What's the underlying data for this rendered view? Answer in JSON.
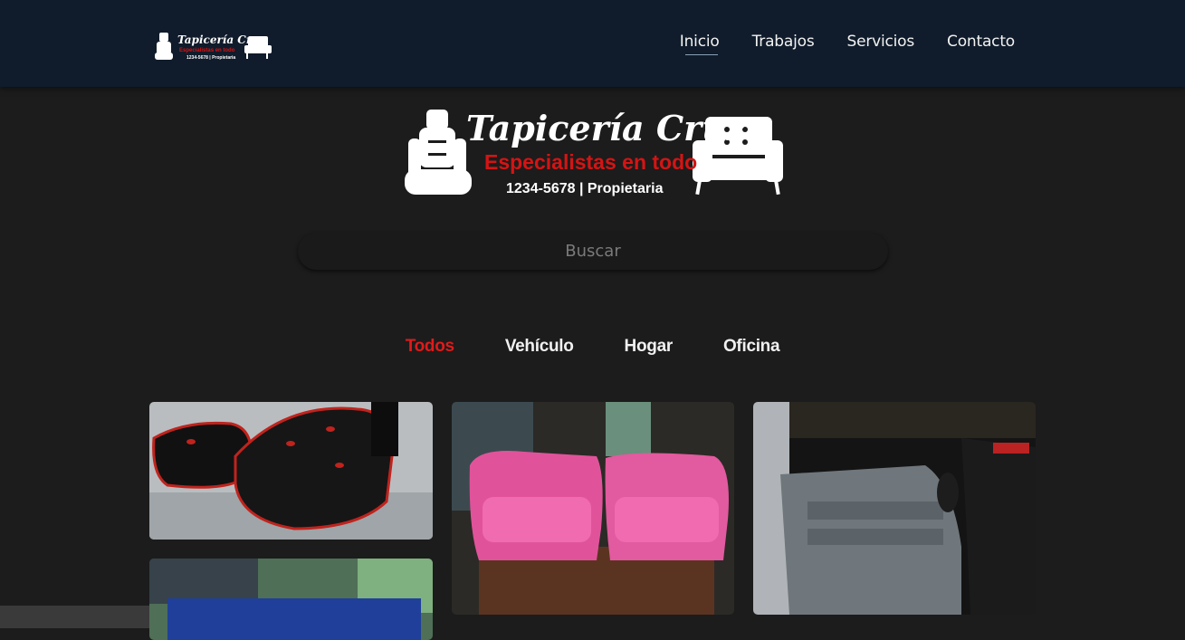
{
  "navbar": {
    "logo": {
      "brand": "Tapicería Cruz",
      "tagline": "Especialistas en todo",
      "phone": "1234-5678 | Propietaria"
    },
    "links": [
      {
        "label": "Inicio",
        "active": true
      },
      {
        "label": "Trabajos",
        "active": false
      },
      {
        "label": "Servicios",
        "active": false
      },
      {
        "label": "Contacto",
        "active": false
      }
    ]
  },
  "hero": {
    "brand": "Tapicería Cruz",
    "tagline": "Especialistas en todo",
    "phone": "1234-5678 | Propietaria"
  },
  "search": {
    "placeholder": "Buscar",
    "value": ""
  },
  "filters": [
    {
      "label": "Todos",
      "active": true
    },
    {
      "label": "Vehículo",
      "active": false
    },
    {
      "label": "Hogar",
      "active": false
    },
    {
      "label": "Oficina",
      "active": false
    }
  ],
  "gallery": [
    {
      "subject": "motorcycle-seat-photo"
    },
    {
      "subject": "pink-armchairs-photo"
    },
    {
      "subject": "car-door-interior-photo"
    },
    {
      "subject": "blue-sofa-photo"
    }
  ],
  "colors": {
    "accent": "#e01a1a",
    "navbar": "#101c2b",
    "background": "#1c1c1c"
  }
}
